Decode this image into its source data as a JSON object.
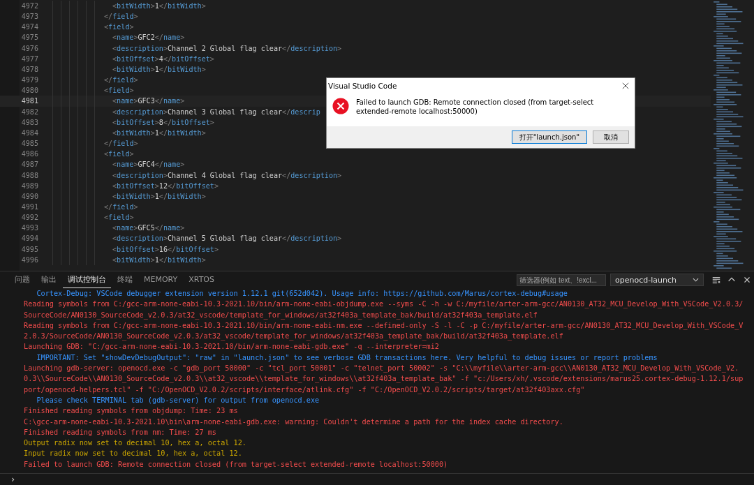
{
  "editor": {
    "lines": [
      {
        "number": "4972",
        "kind": "child",
        "text": "<bitWidth>1</bitWidth>",
        "current": false
      },
      {
        "number": "4973",
        "kind": "field",
        "text": "</field>",
        "current": false
      },
      {
        "number": "4974",
        "kind": "field",
        "text": "<field>",
        "current": false
      },
      {
        "number": "4975",
        "kind": "child",
        "text": "<name>GFC2</name>",
        "current": false
      },
      {
        "number": "4976",
        "kind": "child",
        "text": "<description>Channel 2 Global flag clear</description>",
        "current": false
      },
      {
        "number": "4977",
        "kind": "child",
        "text": "<bitOffset>4</bitOffset>",
        "current": false
      },
      {
        "number": "4978",
        "kind": "child",
        "text": "<bitWidth>1</bitWidth>",
        "current": false
      },
      {
        "number": "4979",
        "kind": "field",
        "text": "</field>",
        "current": false
      },
      {
        "number": "4980",
        "kind": "field",
        "text": "<field>",
        "current": false
      },
      {
        "number": "4981",
        "kind": "child",
        "text": "<name>GFC3</name>",
        "current": true
      },
      {
        "number": "4982",
        "kind": "child",
        "text": "<description>Channel 3 Global flag clear</descrip",
        "current": false
      },
      {
        "number": "4983",
        "kind": "child",
        "text": "<bitOffset>8</bitOffset>",
        "current": false
      },
      {
        "number": "4984",
        "kind": "child",
        "text": "<bitWidth>1</bitWidth>",
        "current": false
      },
      {
        "number": "4985",
        "kind": "field",
        "text": "</field>",
        "current": false
      },
      {
        "number": "4986",
        "kind": "field",
        "text": "<field>",
        "current": false
      },
      {
        "number": "4987",
        "kind": "child",
        "text": "<name>GFC4</name>",
        "current": false
      },
      {
        "number": "4988",
        "kind": "child",
        "text": "<description>Channel 4 Global flag clear</description>",
        "current": false
      },
      {
        "number": "4989",
        "kind": "child",
        "text": "<bitOffset>12</bitOffset>",
        "current": false
      },
      {
        "number": "4990",
        "kind": "child",
        "text": "<bitWidth>1</bitWidth>",
        "current": false
      },
      {
        "number": "4991",
        "kind": "field",
        "text": "</field>",
        "current": false
      },
      {
        "number": "4992",
        "kind": "field",
        "text": "<field>",
        "current": false
      },
      {
        "number": "4993",
        "kind": "child",
        "text": "<name>GFC5</name>",
        "current": false
      },
      {
        "number": "4994",
        "kind": "child",
        "text": "<description>Channel 5 Global flag clear</description>",
        "current": false
      },
      {
        "number": "4995",
        "kind": "child",
        "text": "<bitOffset>16</bitOffset>",
        "current": false
      },
      {
        "number": "4996",
        "kind": "child",
        "text": "<bitWidth>1</bitWidth>",
        "current": false
      }
    ]
  },
  "dialog": {
    "title": "Visual Studio Code",
    "message": "Failed to launch GDB: Remote connection closed (from target-select extended-remote localhost:50000)",
    "buttons": [
      {
        "label": "打开\"launch.json\"",
        "default": true
      },
      {
        "label": "取消",
        "default": false
      }
    ]
  },
  "panel": {
    "tabs": [
      {
        "label": "问题",
        "selected": false
      },
      {
        "label": "输出",
        "selected": false
      },
      {
        "label": "调试控制台",
        "selected": true
      },
      {
        "label": "终端",
        "selected": false
      },
      {
        "label": "MEMORY",
        "selected": false
      },
      {
        "label": "XRTOS",
        "selected": false
      }
    ],
    "filter": {
      "placeholder": "筛选器(例如 text、!excl..."
    },
    "session": "openocd-launch",
    "console": [
      {
        "kind": "info",
        "text": "Cortex-Debug: VSCode debugger extension version 1.12.1 git(652d042). Usage info: https://github.com/Marus/cortex-debug#usage"
      },
      {
        "kind": "error",
        "text": "Reading symbols from C:/gcc-arm-none-eabi-10.3-2021.10/bin/arm-none-eabi-objdump.exe --syms -C -h -w C:/myfile/arter-arm-gcc/AN0130_AT32_MCU_Develop_With_VSCode_V2.0.3/SourceCode/AN0130_SourceCode_v2.0.3/at32_vscode/template_for_windows/at32f403a_template_bak/build/at32f403a_template.elf"
      },
      {
        "kind": "error",
        "text": "Reading symbols from C:/gcc-arm-none-eabi-10.3-2021.10/bin/arm-none-eabi-nm.exe --defined-only -S -l -C -p C:/myfile/arter-arm-gcc/AN0130_AT32_MCU_Develop_With_VSCode_V2.0.3/SourceCode/AN0130_SourceCode_v2.0.3/at32_vscode/template_for_windows/at32f403a_template_bak/build/at32f403a_template.elf"
      },
      {
        "kind": "error",
        "text": "Launching GDB: \"C:/gcc-arm-none-eabi-10.3-2021.10/bin/arm-none-eabi-gdb.exe\" -q --interpreter=mi2"
      },
      {
        "kind": "info",
        "text": "IMPORTANT: Set \"showDevDebugOutput\": \"raw\" in \"launch.json\" to see verbose GDB transactions here. Very helpful to debug issues or report problems"
      },
      {
        "kind": "error",
        "text": "Launching gdb-server: openocd.exe -c \"gdb_port 50000\" -c \"tcl_port 50001\" -c \"telnet_port 50002\" -s \"C:\\\\myfile\\\\arter-arm-gcc\\\\AN0130_AT32_MCU_Develop_With_VSCode_V2.0.3\\\\SourceCode\\\\AN0130_SourceCode_v2.0.3\\\\at32_vscode\\\\template_for_windows\\\\at32f403a_template_bak\" -f \"c:/Users/xh/.vscode/extensions/marus25.cortex-debug-1.12.1/support/openocd-helpers.tcl\" -f \"C:/OpenOCD_V2.0.2/scripts/interface/atlink.cfg\" -f \"C:/OpenOCD_V2.0.2/scripts/target/at32f403axx.cfg\""
      },
      {
        "kind": "info",
        "text": "Please check TERMINAL tab (gdb-server) for output from openocd.exe"
      },
      {
        "kind": "error",
        "text": "Finished reading symbols from objdump: Time: 23 ms"
      },
      {
        "kind": "error",
        "text": "C:\\gcc-arm-none-eabi-10.3-2021.10\\bin\\arm-none-eabi-gdb.exe: warning: Couldn't determine a path for the index cache directory."
      },
      {
        "kind": "error",
        "text": "Finished reading symbols from nm: Time: 27 ms"
      },
      {
        "kind": "warn",
        "text": "Output radix now set to decimal 10, hex a, octal 12."
      },
      {
        "kind": "warn",
        "text": "Input radix now set to decimal 10, hex a, octal 12."
      },
      {
        "kind": "error",
        "text": "Failed to launch GDB: Remote connection closed (from target-select extended-remote localhost:50000)"
      }
    ],
    "prompt": "›"
  }
}
